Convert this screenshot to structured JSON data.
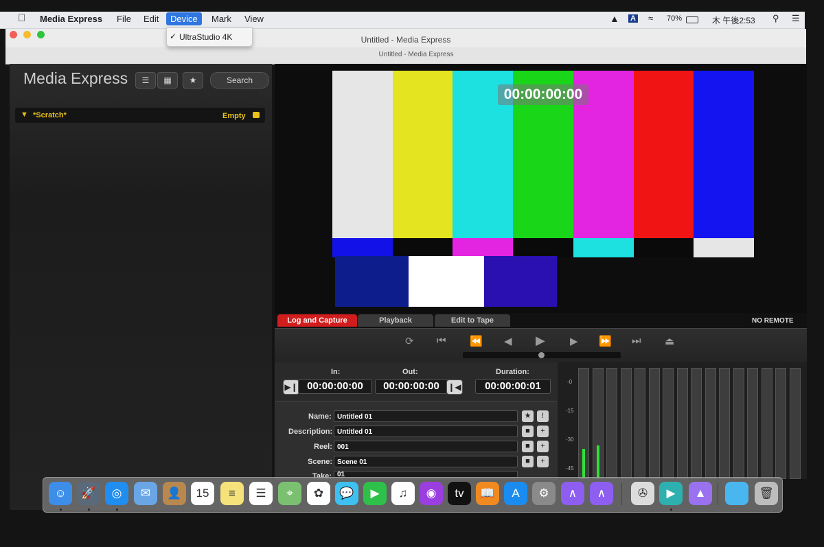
{
  "menubar": {
    "app": "Media Express",
    "items": [
      "File",
      "Edit",
      "Device",
      "Mark",
      "View"
    ],
    "battery": "70%",
    "clock": "木 午後2:53"
  },
  "device_menu": {
    "check": "✓",
    "item": "UltraStudio 4K"
  },
  "window": {
    "title": "Untitled - Media Express",
    "subtitle": "Untitled - Media Express"
  },
  "sidebar": {
    "title": "Media Express",
    "search_label": "Search",
    "bin_name": "*Scratch*",
    "bin_status": "Empty"
  },
  "viewer": {
    "timecode": "00:00:00:00",
    "top_bars": [
      "#e6e6e6",
      "#e4e420",
      "#1de0e0",
      "#19d619",
      "#e324e0",
      "#f01414",
      "#1414f0"
    ],
    "mid_bars": [
      "#1212e8",
      "#0a0a0a",
      "#e324e0",
      "#0a0a0a",
      "#1de0e0",
      "#0a0a0a",
      "#e6e6e6"
    ],
    "bottom_bars": [
      "#0d1e8c",
      "#ffffff",
      "#2a10b0"
    ]
  },
  "tabs": {
    "log": "Log and Capture",
    "playback": "Playback",
    "edit": "Edit to Tape",
    "remote": "NO REMOTE"
  },
  "timecodes": {
    "in_label": "In:",
    "out_label": "Out:",
    "duration_label": "Duration:",
    "in": "00:00:00:00",
    "out": "00:00:00:00",
    "duration": "00:00:00:01"
  },
  "clip": {
    "name_label": "Name:",
    "name": "Untitled 01",
    "description_label": "Description:",
    "description": "Untitled 01",
    "reel_label": "Reel:",
    "reel": "001",
    "scene_label": "Scene:",
    "scene": "Scene 01",
    "take_label": "Take:",
    "take": "01"
  },
  "meters": {
    "scale": [
      "-0",
      "-15",
      "-30",
      "-45"
    ],
    "levels": [
      0.27,
      0.3,
      0,
      0,
      0,
      0,
      0,
      0,
      0,
      0,
      0,
      0,
      0,
      0,
      0,
      0
    ]
  },
  "dock": {
    "icons": [
      {
        "name": "finder-icon",
        "color": "#3c8ee8",
        "glyph": "☺"
      },
      {
        "name": "launchpad-icon",
        "color": "#5a6a7a",
        "glyph": "🚀"
      },
      {
        "name": "safari-icon",
        "color": "#1f8ef0",
        "glyph": "◎"
      },
      {
        "name": "mail-icon",
        "color": "#6aa6e6",
        "glyph": "✉"
      },
      {
        "name": "contacts-icon",
        "color": "#b8884e",
        "glyph": "👤"
      },
      {
        "name": "calendar-icon",
        "color": "#ffffff",
        "glyph": "15"
      },
      {
        "name": "notes-icon",
        "color": "#f6e27a",
        "glyph": "≡"
      },
      {
        "name": "reminders-icon",
        "color": "#ffffff",
        "glyph": "☰"
      },
      {
        "name": "maps-icon",
        "color": "#7ac070",
        "glyph": "⌖"
      },
      {
        "name": "photos-icon",
        "color": "#ffffff",
        "glyph": "✿"
      },
      {
        "name": "messages-icon",
        "color": "#3ec0f0",
        "glyph": "💬"
      },
      {
        "name": "facetime-icon",
        "color": "#2fc04a",
        "glyph": "▶"
      },
      {
        "name": "music-icon",
        "color": "#ffffff",
        "glyph": "♫"
      },
      {
        "name": "podcasts-icon",
        "color": "#9b3ee0",
        "glyph": "◉"
      },
      {
        "name": "apple-tv-icon",
        "color": "#111111",
        "glyph": "tv"
      },
      {
        "name": "books-icon",
        "color": "#f08a20",
        "glyph": "📖"
      },
      {
        "name": "app-store-icon",
        "color": "#1a8cf0",
        "glyph": "A"
      },
      {
        "name": "system-preferences-icon",
        "color": "#8a8a8a",
        "glyph": "⚙"
      },
      {
        "name": "blackmagic-app-icon",
        "color": "#8e5ef0",
        "glyph": "∧"
      },
      {
        "name": "blackmagic-app-icon-2",
        "color": "#8e5ef0",
        "glyph": "∧"
      },
      {
        "name": "media-express-icon",
        "color": "#dcdcdc",
        "glyph": "✇"
      },
      {
        "name": "disk-utility-icon",
        "color": "#2fb0b0",
        "glyph": "▶"
      },
      {
        "name": "blackmagic-desktop-setup-icon",
        "color": "#9a72f0",
        "glyph": "▲"
      },
      {
        "name": "downloads-folder-icon",
        "color": "#4ab6f0",
        "glyph": ""
      },
      {
        "name": "trash-icon",
        "color": "#bdbdbd",
        "glyph": "🗑"
      }
    ]
  }
}
